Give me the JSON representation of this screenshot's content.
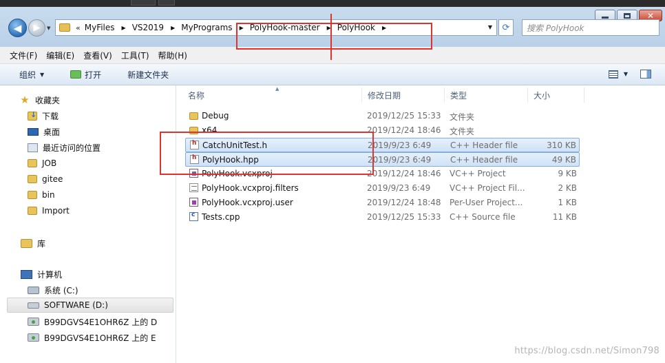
{
  "nav_buttons": {
    "back": "◀",
    "forward": "▶"
  },
  "address": {
    "overflow": "«",
    "crumbs": [
      "MyFiles",
      "VS2019",
      "MyPrograms",
      "PolyHook-master",
      "PolyHook"
    ]
  },
  "search": {
    "placeholder": "搜索 PolyHook"
  },
  "menu": [
    "文件(F)",
    "编辑(E)",
    "查看(V)",
    "工具(T)",
    "帮助(H)"
  ],
  "toolbar": {
    "organize": "组织",
    "open": "打开",
    "new_folder": "新建文件夹"
  },
  "navpane": {
    "favorites": "收藏夹",
    "favorite_items": [
      "下载",
      "桌面",
      "最近访问的位置",
      "JOB",
      "gitee",
      "bin",
      "Import"
    ],
    "libraries": "库",
    "computer": "计算机",
    "drives": [
      "系统 (C:)",
      "SOFTWARE (D:)",
      "B99DGVS4E1OHR6Z 上的 D",
      "B99DGVS4E1OHR6Z 上的 E"
    ]
  },
  "columns": {
    "name": "名称",
    "date": "修改日期",
    "type": "类型",
    "size": "大小"
  },
  "files": [
    {
      "name": "Debug",
      "date": "2019/12/25 15:33",
      "type": "文件夹",
      "size": "",
      "icon": "folder-icon"
    },
    {
      "name": "x64",
      "date": "2019/12/24 18:46",
      "type": "文件夹",
      "size": "",
      "icon": "folder-icon"
    },
    {
      "name": "CatchUnitTest.h",
      "date": "2019/9/23 6:49",
      "type": "C++ Header file",
      "size": "310 KB",
      "icon": "header-file-icon"
    },
    {
      "name": "PolyHook.hpp",
      "date": "2019/9/23 6:49",
      "type": "C++ Header file",
      "size": "49 KB",
      "icon": "header-file-icon"
    },
    {
      "name": "PolyHook.vcxproj",
      "date": "2019/12/24 18:46",
      "type": "VC++ Project",
      "size": "9 KB",
      "icon": "project-file-icon"
    },
    {
      "name": "PolyHook.vcxproj.filters",
      "date": "2019/9/23 6:49",
      "type": "VC++ Project Fil...",
      "size": "2 KB",
      "icon": "filters-file-icon"
    },
    {
      "name": "PolyHook.vcxproj.user",
      "date": "2019/12/24 18:48",
      "type": "Per-User Project...",
      "size": "1 KB",
      "icon": "user-file-icon"
    },
    {
      "name": "Tests.cpp",
      "date": "2019/12/25 15:33",
      "type": "C++ Source file",
      "size": "11 KB",
      "icon": "source-file-icon"
    }
  ],
  "watermark": "https://blog.csdn.net/Simon798",
  "colors": {
    "annotation": "#e0322d",
    "selection": "#cfe2f7"
  }
}
